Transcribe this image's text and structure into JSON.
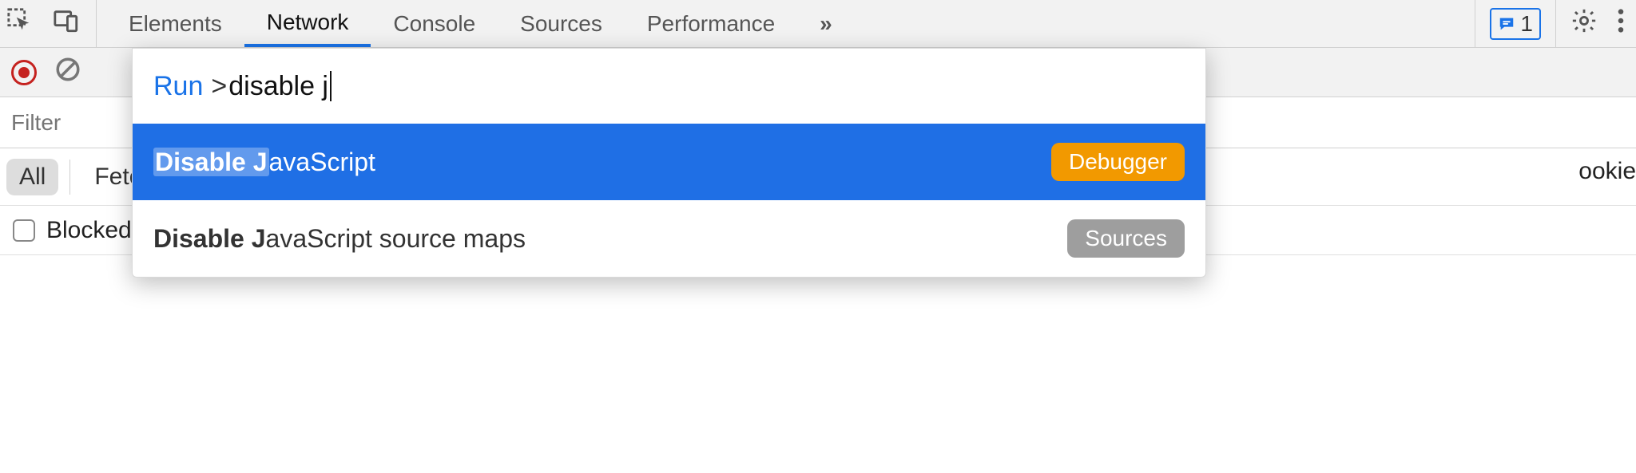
{
  "tabs": {
    "items": [
      {
        "label": "Elements",
        "active": false
      },
      {
        "label": "Network",
        "active": true
      },
      {
        "label": "Console",
        "active": false
      },
      {
        "label": "Sources",
        "active": false
      },
      {
        "label": "Performance",
        "active": false
      }
    ],
    "overflow_glyph": "»"
  },
  "issues": {
    "count": "1"
  },
  "filter": {
    "placeholder": "Filter"
  },
  "chips": {
    "all": "All",
    "fetch": "Fetch"
  },
  "cookies_tail": "ookie",
  "blocked": {
    "label": "Blocked"
  },
  "palette": {
    "run_label": "Run",
    "prompt_prefix": ">",
    "query": "disable j",
    "rows": [
      {
        "prefix_bold": "Disable J",
        "rest": "avaScript",
        "badge": "Debugger",
        "badge_color": "orange",
        "selected": true
      },
      {
        "prefix_bold": "Disable J",
        "rest": "avaScript source maps",
        "badge": "Sources",
        "badge_color": "gray",
        "selected": false
      }
    ]
  }
}
